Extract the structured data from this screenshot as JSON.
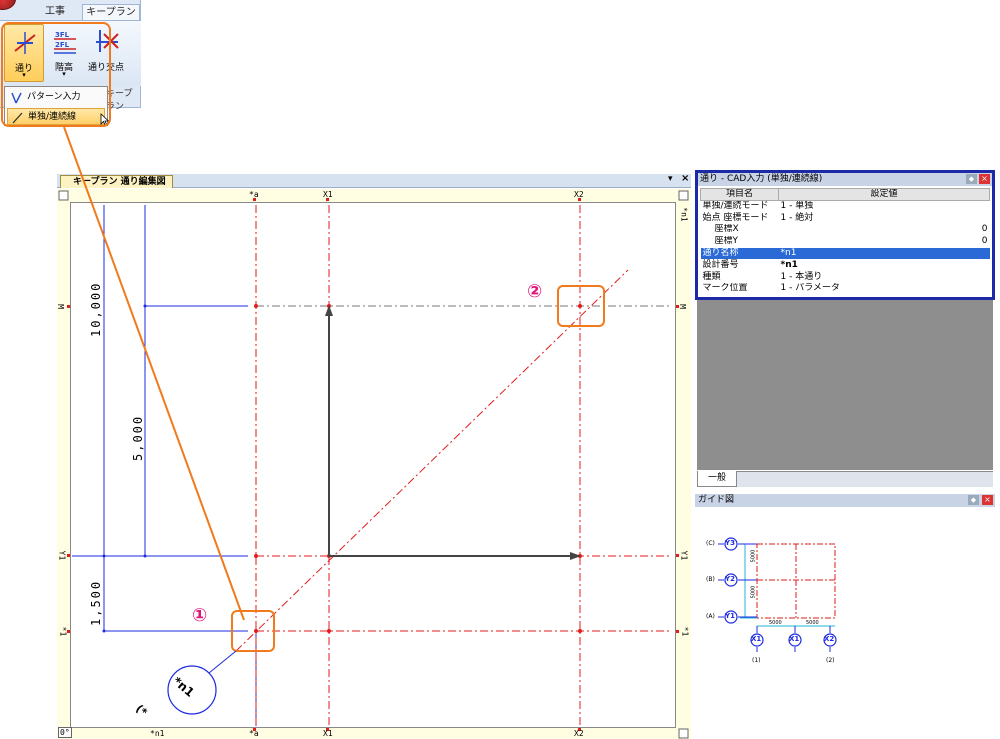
{
  "ribbon": {
    "tabs": [
      "工事",
      "キープラン"
    ],
    "buttons": [
      {
        "label": "通り",
        "icon": "grid-line-icon"
      },
      {
        "label": "階高",
        "icon": "floor-height-icon"
      },
      {
        "label": "通り交点",
        "icon": "intersection-icon"
      }
    ],
    "group_label": "キープラン",
    "dropdown_arrow": "▾"
  },
  "dropdown": {
    "items": [
      "パターン入力",
      "単独/連続線"
    ]
  },
  "drawing": {
    "tab_title": "キープラン 通り編集図",
    "pin": "▾",
    "close": "×",
    "top_labels": [
      "*a",
      "X1",
      "X2"
    ],
    "bottom_labels": [
      "*n1",
      "*a",
      "X1",
      "X2"
    ],
    "left_labels": [
      "M",
      "Y1",
      "*1"
    ],
    "right_labels": [
      "*n1",
      "M",
      "Y1",
      "*1"
    ],
    "corner_label": "0°",
    "dims": [
      "10,000",
      "5,000",
      "1,500"
    ],
    "circle_label": "*n1",
    "circle_paren": "(*",
    "marker1": "①",
    "marker2": "②"
  },
  "properties": {
    "title": "通り - CAD入力 (単独/連続線)",
    "headers": [
      "項目名",
      "設定値"
    ],
    "rows": [
      {
        "key": "単独/連続モード",
        "value": "1 - 単独",
        "indent": false
      },
      {
        "key": "始点 座標モード",
        "value": "1 - 絶対",
        "indent": false
      },
      {
        "key": "座標X",
        "value": "0",
        "indent": true,
        "num": true
      },
      {
        "key": "座標Y",
        "value": "0",
        "indent": true,
        "num": true
      },
      {
        "key": "通り名称",
        "value": "*n1",
        "indent": false,
        "selected": true
      },
      {
        "key": "設計番号",
        "value": "*n1",
        "indent": false,
        "bold": true
      },
      {
        "key": "種類",
        "value": "1 - 本通り",
        "indent": false
      },
      {
        "key": "マーク位置",
        "value": "1 - パラメータ",
        "indent": false
      }
    ],
    "tab": "一般",
    "close": "×",
    "pin": "◆"
  },
  "guide": {
    "title": "ガイド図",
    "y_marks": [
      {
        "paren": "(C)",
        "label": "Y3"
      },
      {
        "paren": "(B)",
        "label": "Y2"
      },
      {
        "paren": "(A)",
        "label": "Y1"
      }
    ],
    "x_marks": [
      {
        "label": "X1",
        "paren": "(1)"
      },
      {
        "label": "X1",
        "paren": ""
      },
      {
        "label": "X2",
        "paren": "(2)"
      }
    ],
    "dims": [
      "5000",
      "5000",
      "5000",
      "5000"
    ],
    "close": "×",
    "pin": "◆"
  },
  "colors": {
    "accent_orange": "#f07a1c",
    "highlight_pink": "#e0167a",
    "grid_red": "#e21b1b",
    "dim_blue": "#1c2be0",
    "panel_border": "#1d2aa8"
  }
}
